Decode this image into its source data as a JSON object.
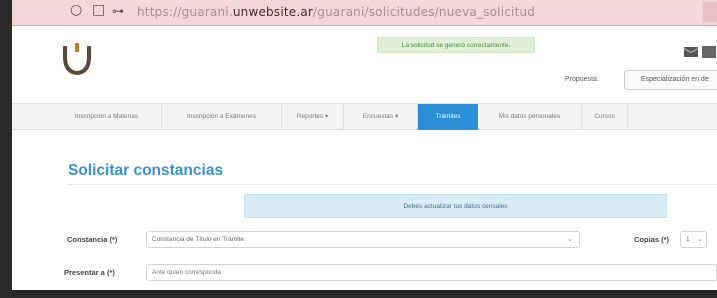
{
  "browser": {
    "url_prefix": "https://guarani.",
    "url_domain": "unwebsite.ar",
    "url_path": "/guarani/solicitudes/nueva_solicitud",
    "back_icon": "circle-icon",
    "reload_icon": "square-icon"
  },
  "header": {
    "logo_icon": "university-shield-logo",
    "success_message": "La solicitud se generó correctamente.",
    "mail_icon": "mail-icon",
    "user_icon": "user-icon",
    "propuesta_label": "Propuesta:",
    "propuesta_value": "Especialización en de"
  },
  "menu": {
    "items": [
      {
        "label": "Inscripción a Materias"
      },
      {
        "label": "Inscripción a Exámenes"
      },
      {
        "label": "Reportes ▾"
      },
      {
        "label": "Encuestas ▾"
      },
      {
        "label": "Trámites"
      },
      {
        "label": "Mis datos personales"
      },
      {
        "label": "Cursos"
      }
    ],
    "active_color": "#2a8fd6"
  },
  "page": {
    "title": "Solicitar constancias",
    "info_alert": "Debés actualizar tus datos censales",
    "constancia_label": "Constancia (*)",
    "constancia_value": "Constancia de Título en Trámite",
    "copias_label": "Copias (*)",
    "copias_value": "1",
    "presentar_label": "Presentar a (*)",
    "presentar_value": "Ante quien corresponda"
  }
}
